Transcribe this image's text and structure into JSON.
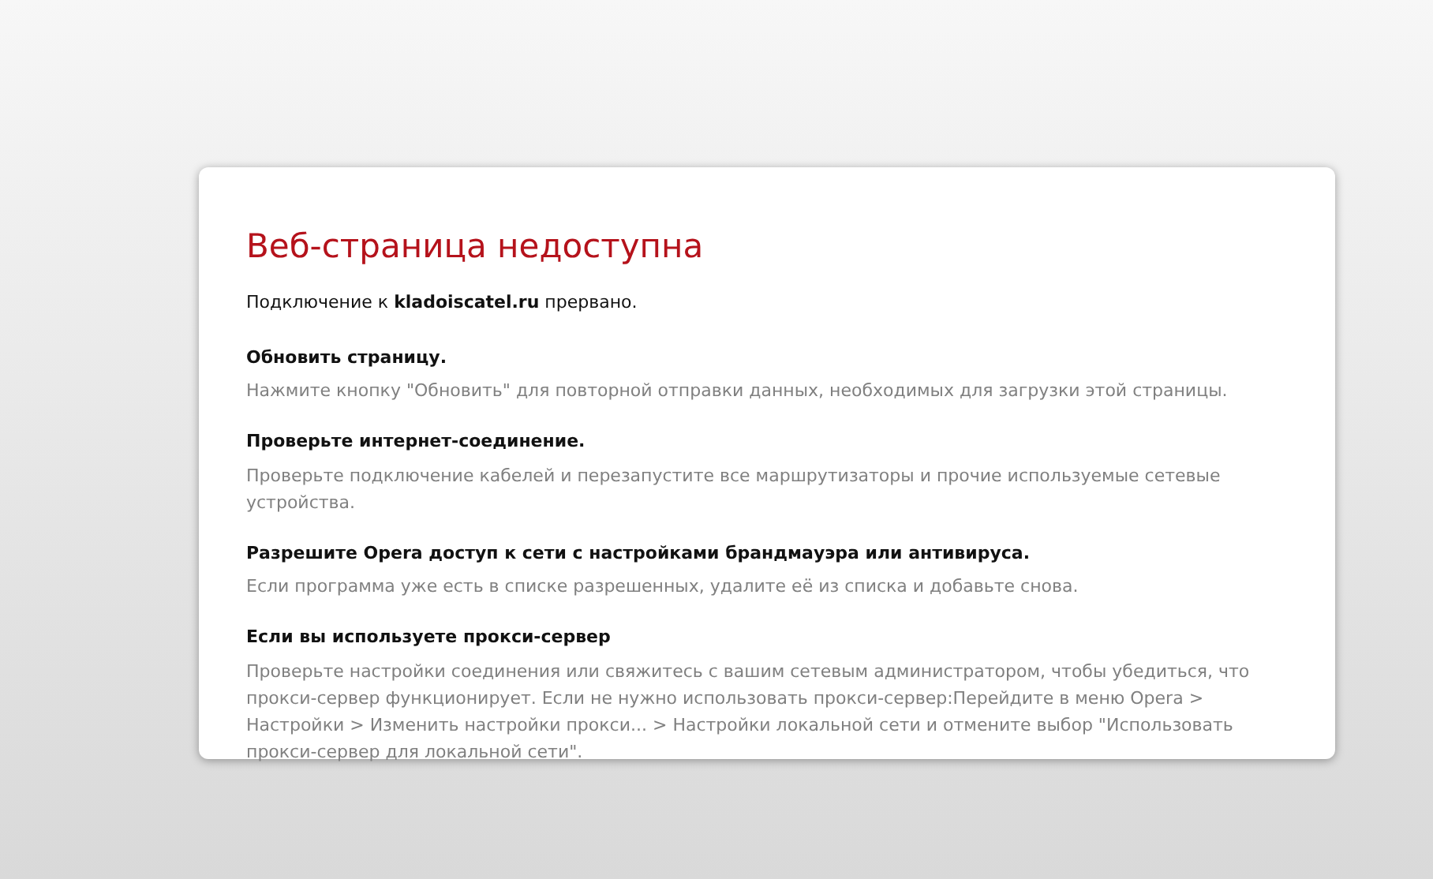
{
  "title": "Веб-страница недоступна",
  "message": "Подключение к **kladoiscatel.ru** прервано.",
  "tips": [
    {
      "heading": "Обновить страницу.",
      "text": "Нажмите кнопку \"Обновить\" для повторной отправки данных, необходимых для загрузки этой страницы."
    },
    {
      "heading": "Проверьте интернет-соединение.",
      "text": "Проверьте подключение кабелей и перезапустите все маршрутизаторы и прочие используемые сетевые устройства."
    },
    {
      "heading": "Разрешите Opera доступ к сети с настройками брандмауэра или антивируса.",
      "text": "Если программа уже есть в списке разрешенных, удалите её из списка и добавьте снова."
    },
    {
      "heading": "Если вы используете прокси-сервер",
      "text": "Проверьте настройки соединения или свяжитесь с вашим сетевым администратором, чтобы убедиться, что прокси-сервер функционирует. Если не нужно использовать прокси-сервер:Перейдите в меню Opera > Настройки > Изменить настройки прокси... > Настройки локальной сети и отмените выбор \"Использовать прокси-сервер для локальной сети\"."
    }
  ]
}
